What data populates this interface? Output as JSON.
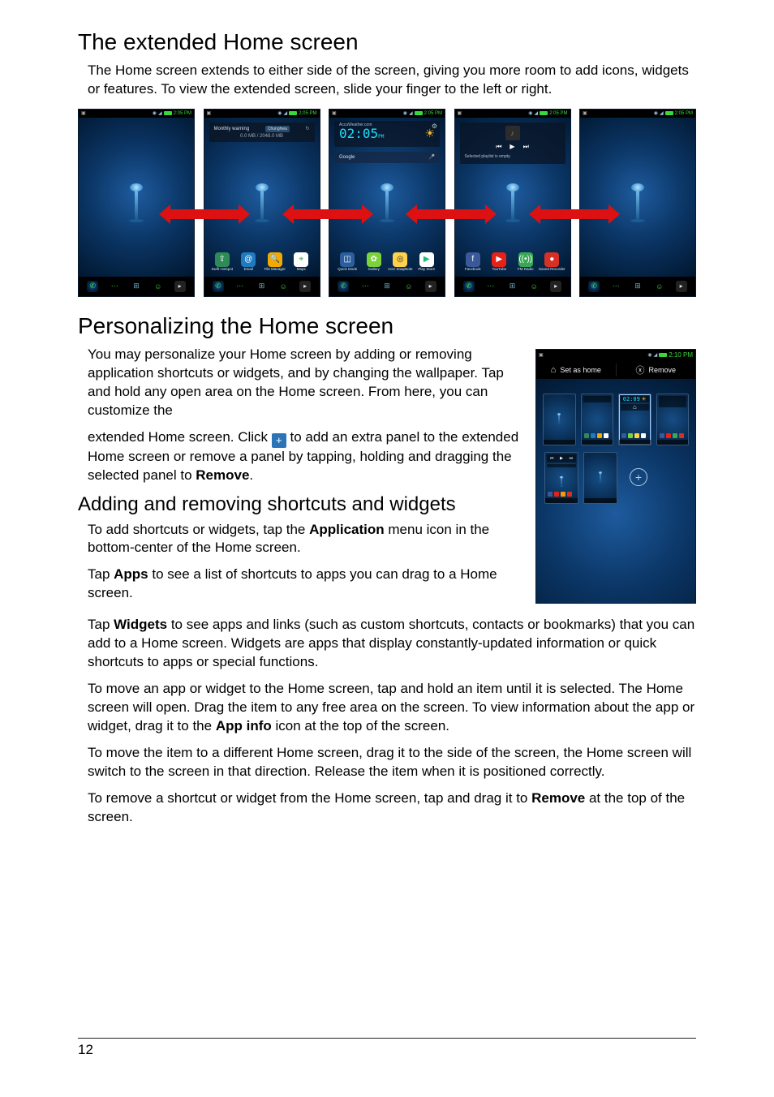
{
  "section1": {
    "heading": "The extended Home screen"
  },
  "p1": "The Home screen extends to either side of the screen, giving you more room to add icons, widgets or features. To view the extended screen, slide your finger to the left or right.",
  "status": {
    "time": "2:05",
    "ampm": "PM"
  },
  "widget_monthly": {
    "label": "Monthly warning",
    "carrier": "Chunghwa",
    "usage": "0.0 MB / 2048.0 MB"
  },
  "accu": {
    "brand": "AccuWeather.com",
    "time": "02:05",
    "suffix": "PM"
  },
  "search": {
    "placeholder": "Google"
  },
  "player": {
    "caption": "Selected playlist is empty."
  },
  "apps_row2": {
    "a0": {
      "label": "Swift Hotspot"
    },
    "a1": {
      "label": "Email"
    },
    "a2": {
      "label": "File Manager"
    },
    "a3": {
      "label": "Maps"
    }
  },
  "apps_center": {
    "c0": {
      "label": "Quick Mode"
    },
    "c1": {
      "label": "Gallery"
    },
    "c2": {
      "label": "Acer SnapNote"
    },
    "c3": {
      "label": "Play Store"
    }
  },
  "apps_right": {
    "r0": {
      "label": "Facebook"
    },
    "r1": {
      "label": "YouTube"
    },
    "r2": {
      "label": "FM Radio"
    },
    "r3": {
      "label": "Sound Recorder"
    }
  },
  "section2": {
    "heading": "Personalizing the Home screen"
  },
  "p2": "You may personalize your Home screen by adding or removing application shortcuts or widgets, and by changing the wallpaper. Tap and hold any open area on the Home screen. From here, you can customize the",
  "p3a": "extended Home screen. Click ",
  "p3b": " to add an extra panel to the extended Home screen or remove a panel by tapping, holding and dragging the selected panel to ",
  "p3_bold": "Remove",
  "p3c": ".",
  "sidefig": {
    "statustime": "2:10",
    "statussuffix": "PM",
    "set_as_home": "Set as home",
    "remove": "Remove",
    "mini_time": "02:09"
  },
  "section3": {
    "heading": "Adding and removing shortcuts and widgets"
  },
  "p4a": "To add shortcuts or widgets, tap the ",
  "p4_bold": "Application",
  "p4b": " menu icon in the bottom-center of the Home screen.",
  "p5a": "Tap ",
  "p5_bold": "Apps",
  "p5b": " to see a list of shortcuts to apps you can drag to a Home screen.",
  "p6a": "Tap ",
  "p6_bold": "Widgets",
  "p6b": " to see apps and links (such as custom shortcuts, contacts or bookmarks) that you can add to a Home screen. Widgets are apps that display constantly-updated information or quick shortcuts to apps or special functions.",
  "p7a": "To move an app or widget to the Home screen, tap and hold an item until it is selected. The Home screen will open. Drag the item to any free area on the screen. To view information about the app or widget, drag it to the ",
  "p7_bold": "App info",
  "p7b": " icon at the top of the screen.",
  "p8": "To move the item to a different Home screen, drag it to the side of the screen, the Home screen will switch to the screen in that direction. Release the item when it is positioned correctly.",
  "p9a": "To remove a shortcut or widget from the Home screen, tap and drag it to ",
  "p9_bold": "Remove",
  "p9b": " at the top of the screen.",
  "page_number": "12"
}
